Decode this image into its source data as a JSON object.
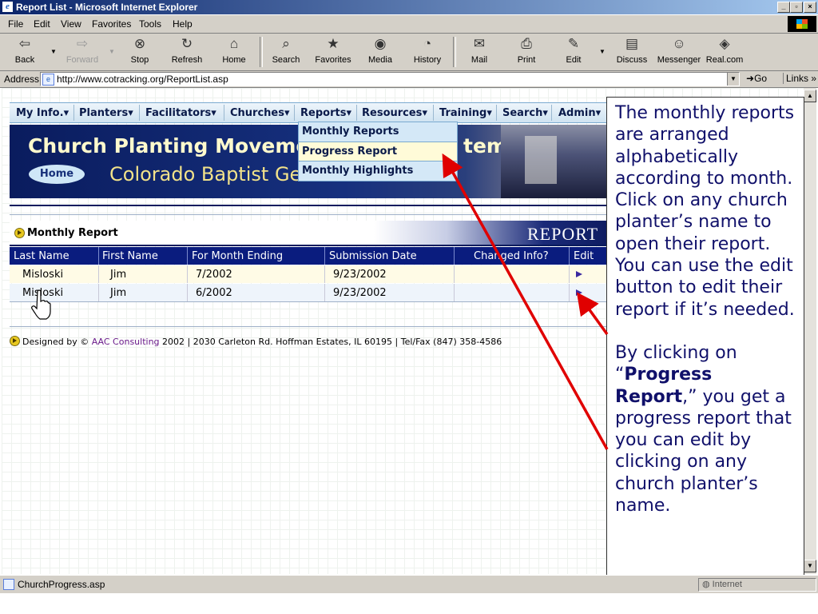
{
  "window": {
    "title": "Report List - Microsoft Internet Explorer"
  },
  "menubar": {
    "items": [
      "File",
      "Edit",
      "View",
      "Favorites",
      "Tools",
      "Help"
    ]
  },
  "toolbar": {
    "back": "Back",
    "forward": "Forward",
    "stop": "Stop",
    "refresh": "Refresh",
    "home": "Home",
    "search": "Search",
    "favorites": "Favorites",
    "media": "Media",
    "history": "History",
    "mail": "Mail",
    "print": "Print",
    "edit": "Edit",
    "discuss": "Discuss",
    "messenger": "Messenger",
    "realcom": "Real.com"
  },
  "addressbar": {
    "label": "Address",
    "url": "http://www.cotracking.org/ReportList.asp",
    "go": "Go",
    "links": "Links"
  },
  "site_nav": {
    "items": [
      "My Info.",
      "Planters",
      "Facilitators",
      "Churches",
      "Reports",
      "Resources",
      "Training",
      "Search",
      "Admin"
    ]
  },
  "banner": {
    "title": "Church Planting Moveme",
    "title_end": "tem",
    "subtitle": "Colorado Baptist Gene",
    "home_button": "Home"
  },
  "reports_menu": {
    "items": [
      "Monthly Reports",
      "Progress Report",
      "Monthly Highlights"
    ]
  },
  "report": {
    "section_title": "Monthly Report",
    "banner_text": "Report",
    "columns": [
      "Last Name",
      "First Name",
      "For Month Ending",
      "Submission Date",
      "Changed Info?",
      "Edit"
    ],
    "rows": [
      {
        "last_name": "Misloski",
        "first_name": "Jim",
        "month_ending": "7/2002",
        "submission_date": "9/23/2002",
        "changed_info": ""
      },
      {
        "last_name": "Misloski",
        "first_name": "Jim",
        "month_ending": "6/2002",
        "submission_date": "9/23/2002",
        "changed_info": ""
      }
    ]
  },
  "footer": {
    "prefix": "Designed by ",
    "company": "AAC Consulting",
    "rest": " 2002 | 2030 Carleton Rd. Hoffman Estates, IL 60195 | Tel/Fax (847) 358-4586"
  },
  "callout": {
    "p1": "The monthly reports are arranged alphabetically according to month.  Click on any church planter’s name to open their report. You can use the edit button to edit their report if it’s needed.",
    "p2_before": "By clicking on “",
    "p2_bold": "Progress Report",
    "p2_after": ",” you get a progress report that you can edit by clicking on any church planter’s name."
  },
  "statusbar": {
    "text": "ChurchProgress.asp",
    "zone": "Internet"
  },
  "colors": {
    "title_bar": "#0a246a",
    "nav_bg": "#d4e8f7",
    "table_header": "#0a1c7e",
    "callout_text": "#10106a",
    "arrow": "#e00000"
  }
}
